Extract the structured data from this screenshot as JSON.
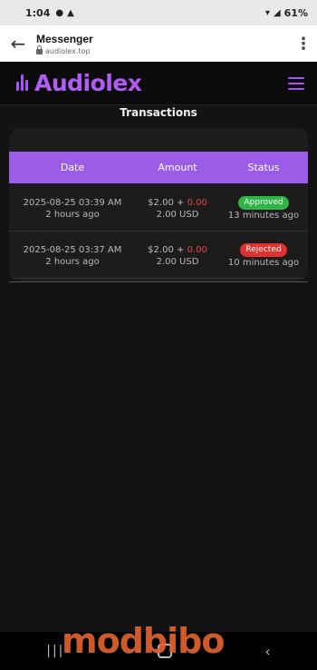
{
  "statusbar": {
    "time": "1:04",
    "battery": "61%"
  },
  "browser": {
    "title": "Messenger",
    "url": "audiolex.top"
  },
  "site": {
    "logo": "Audiolex"
  },
  "page": {
    "heading": "Transactions"
  },
  "table": {
    "headers": [
      "Date",
      "Amount",
      "Status"
    ],
    "rows": [
      {
        "date": "2025-08-25 03:39 AM",
        "ago": "2 hours ago",
        "base": "$2.00",
        "plus": " + ",
        "extra": "0.00",
        "total": "2.00 USD",
        "status": "Approved",
        "status_ago": "13 minutes ago"
      },
      {
        "date": "2025-08-25 03:37 AM",
        "ago": "2 hours ago",
        "base": "$2.00",
        "plus": " + ",
        "extra": "0.00",
        "total": "2.00 USD",
        "status": "Rejected",
        "status_ago": "10 minutes ago"
      }
    ]
  },
  "watermark": "modbibo",
  "colors": {
    "accent": "#9b5de5",
    "approved": "#2fb545",
    "rejected": "#e0312f"
  }
}
